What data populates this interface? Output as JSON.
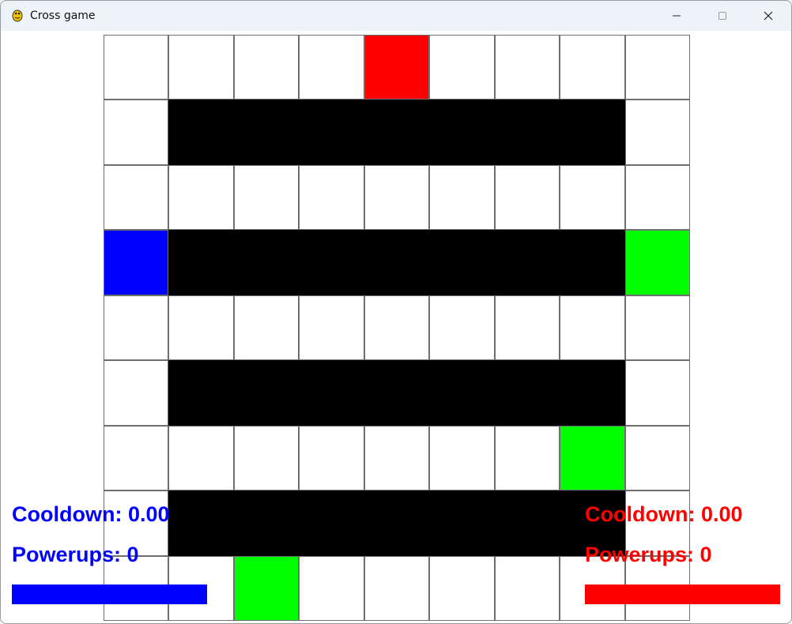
{
  "window": {
    "title": "Cross game",
    "app_icon": "pygame-snake-icon",
    "controls": [
      "minimize-icon",
      "maximize-icon",
      "close-icon"
    ]
  },
  "board": {
    "rows": 9,
    "cols": 9,
    "walls_rows": [
      1,
      3,
      5,
      7
    ],
    "walls_col_span": [
      1,
      7
    ],
    "player_red": {
      "row": 0,
      "col": 4,
      "color": "#ff0000"
    },
    "player_blue": {
      "row": 3,
      "col": 0,
      "color": "#0000ff"
    },
    "powerups": [
      {
        "row": 3,
        "col": 8
      },
      {
        "row": 6,
        "col": 7
      },
      {
        "row": 8,
        "col": 2
      }
    ],
    "powerup_color": "#00ff00",
    "wall_color": "#000000"
  },
  "hud": {
    "blue": {
      "cooldown": "Cooldown: 0.00",
      "powerups": "Powerups: 0",
      "color": "#0000ff",
      "bar_fill": 1.0
    },
    "red": {
      "cooldown": "Cooldown: 0.00",
      "powerups": "Powerups: 0",
      "color": "#ff0000",
      "bar_fill": 1.0
    }
  }
}
